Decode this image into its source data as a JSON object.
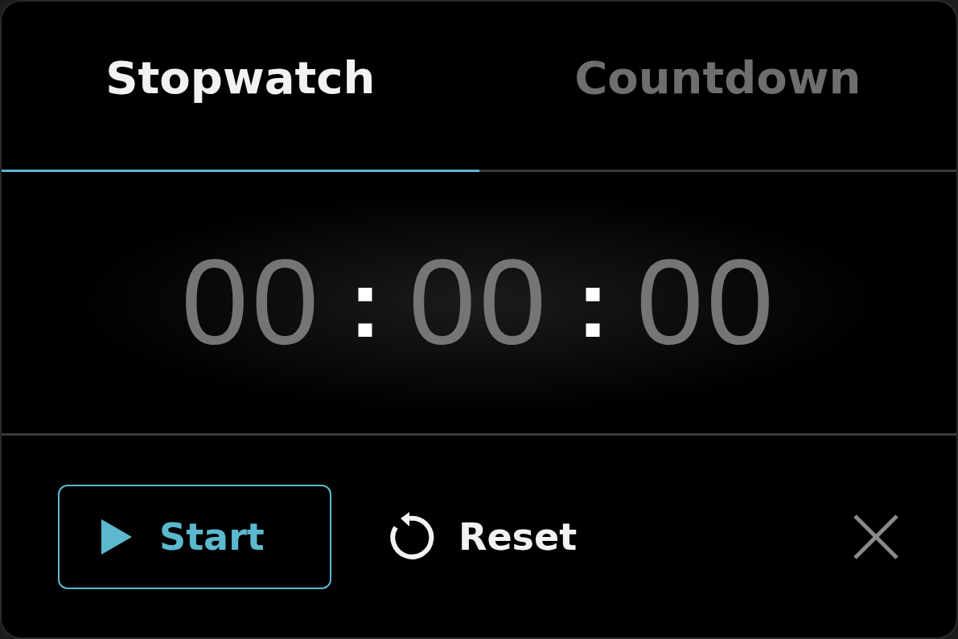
{
  "tabs": [
    {
      "label": "Stopwatch",
      "selected": true
    },
    {
      "label": "Countdown",
      "selected": false
    }
  ],
  "timer": [
    {
      "kind": "digits",
      "text": "00"
    },
    {
      "kind": "separator",
      "text": ":"
    },
    {
      "kind": "digits",
      "text": "00"
    },
    {
      "kind": "separator",
      "text": ":"
    },
    {
      "kind": "digits",
      "text": "00"
    }
  ],
  "actions": [
    {
      "kind": "start",
      "label": "Start"
    },
    {
      "kind": "reset",
      "label": "Reset"
    },
    {
      "kind": "close"
    }
  ]
}
